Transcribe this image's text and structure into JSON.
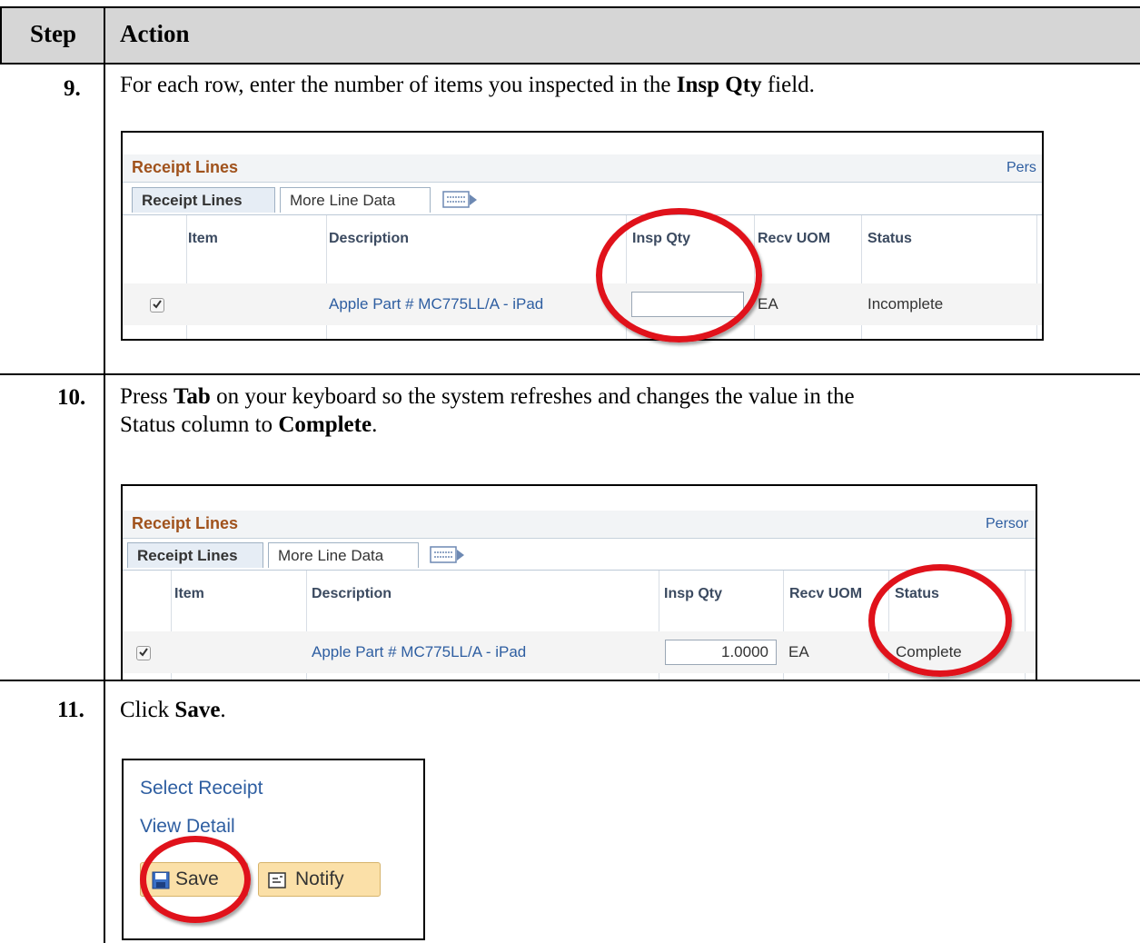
{
  "header": {
    "col_step": "Step",
    "col_action": "Action"
  },
  "steps": [
    {
      "number": "9.",
      "text_parts": [
        "For each row, enter the number of items you inspected in the ",
        "Insp Qty",
        " field."
      ],
      "screenshot": {
        "grid_title": "Receipt Lines",
        "personalize_link": "Pers",
        "tabs": [
          "Receipt Lines",
          "More Line Data"
        ],
        "columns": [
          "Item",
          "Description",
          "Insp Qty",
          "Recv UOM",
          "Status"
        ],
        "row": {
          "checked": true,
          "item": "",
          "description": "Apple Part # MC775LL/A - iPad",
          "insp_qty": "",
          "recv_uom": "EA",
          "status": "Incomplete"
        }
      }
    },
    {
      "number": "10.",
      "text_line1_parts": [
        "Press ",
        "Tab",
        " on your keyboard so the system refreshes and changes the value in the"
      ],
      "text_line2_parts": [
        "Status column to ",
        "Complete",
        "."
      ],
      "screenshot": {
        "grid_title": "Receipt Lines",
        "personalize_link": "Persor",
        "tabs": [
          "Receipt Lines",
          "More Line Data"
        ],
        "columns": [
          "Item",
          "Description",
          "Insp Qty",
          "Recv UOM",
          "Status"
        ],
        "row": {
          "checked": true,
          "item": "",
          "description": "Apple Part # MC775LL/A - iPad",
          "insp_qty": "1.0000",
          "recv_uom": "EA",
          "status": "Complete"
        }
      }
    },
    {
      "number": "11.",
      "text_parts": [
        "Click ",
        "Save",
        "."
      ],
      "screenshot": {
        "links": [
          "Select Receipt",
          "View Detail"
        ],
        "buttons": [
          "Save",
          "Notify"
        ]
      }
    }
  ],
  "colors": {
    "highlight_oval": "#e0121b",
    "link": "#2e5ea1",
    "grid_title": "#a0521c",
    "button_bg": "#fbe0a8"
  }
}
